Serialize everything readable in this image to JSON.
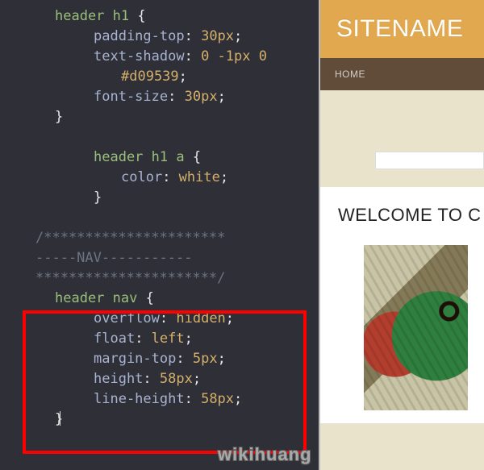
{
  "editor": {
    "rules": [
      {
        "selector": "header h1",
        "decls": [
          {
            "prop": "padding-top",
            "val": "30px"
          },
          {
            "prop": "text-shadow",
            "val": "0 -1px 0"
          },
          {
            "cont": "#d09539"
          },
          {
            "prop": "font-size",
            "val": "30px"
          }
        ]
      },
      {
        "selector": "header h1 a",
        "decls": [
          {
            "prop": "color",
            "val": "white"
          }
        ],
        "extra_indent": true
      }
    ],
    "comment_block": {
      "top": "/**********************",
      "mid": "-----NAV-----------",
      "bottom": "**********************/"
    },
    "nav_rule": {
      "selector": "header nav",
      "decls": [
        {
          "prop": "overflow",
          "val": "hidden"
        },
        {
          "prop": "float",
          "val": "left"
        },
        {
          "prop": "margin-top",
          "val": "5px"
        },
        {
          "prop": "height",
          "val": "58px"
        },
        {
          "prop": "line-height",
          "val": "58px"
        }
      ]
    }
  },
  "preview": {
    "sitename": "SITENAME",
    "nav_item": "HOME",
    "heading": "WELCOME TO C"
  },
  "watermark": "wikihuang"
}
